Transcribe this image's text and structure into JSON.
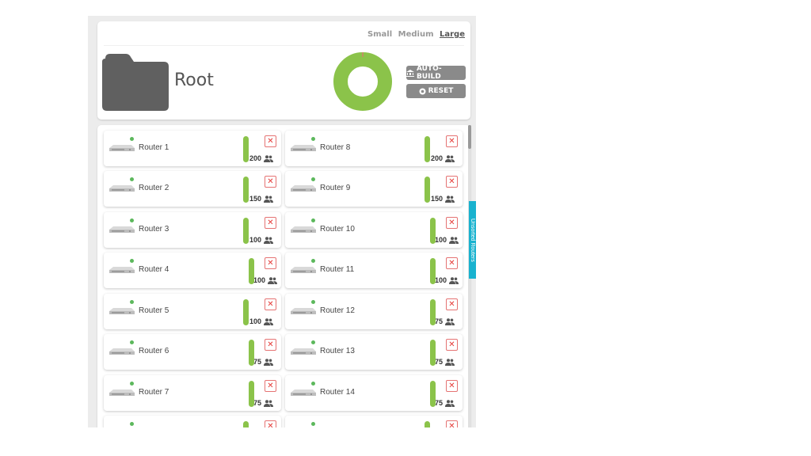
{
  "header": {
    "sizes": [
      {
        "label": "Small",
        "active": false
      },
      {
        "label": "Medium",
        "active": false
      },
      {
        "label": "Large",
        "active": true
      }
    ],
    "title": "Root",
    "auto_build_label": "AUTO-BUILD",
    "reset_label": "RESET",
    "donut": {
      "fill": 0.995,
      "color": "#8bc34a",
      "accent": "#e57373"
    }
  },
  "side_tab_label": "Unsorted Routers",
  "routers": [
    {
      "name": "Router 1",
      "count": "200",
      "level": 1.0
    },
    {
      "name": "Router 8",
      "count": "200",
      "level": 1.0
    },
    {
      "name": "Router 2",
      "count": "150",
      "level": 1.0
    },
    {
      "name": "Router 9",
      "count": "150",
      "level": 1.0
    },
    {
      "name": "Router 3",
      "count": "100",
      "level": 1.0
    },
    {
      "name": "Router 10",
      "count": "100",
      "level": 1.0
    },
    {
      "name": "Router 4",
      "count": "100",
      "level": 1.0
    },
    {
      "name": "Router 11",
      "count": "100",
      "level": 1.0
    },
    {
      "name": "Router 5",
      "count": "100",
      "level": 1.0
    },
    {
      "name": "Router 12",
      "count": "75",
      "level": 1.0
    },
    {
      "name": "Router 6",
      "count": "75",
      "level": 1.0
    },
    {
      "name": "Router 13",
      "count": "75",
      "level": 1.0
    },
    {
      "name": "Router 7",
      "count": "75",
      "level": 1.0
    },
    {
      "name": "Router 14",
      "count": "75",
      "level": 1.0
    }
  ],
  "colors": {
    "accent": "#8bc34a",
    "status": "#5cb85c",
    "remove": "#e53935",
    "tab": "#19b2cf"
  }
}
